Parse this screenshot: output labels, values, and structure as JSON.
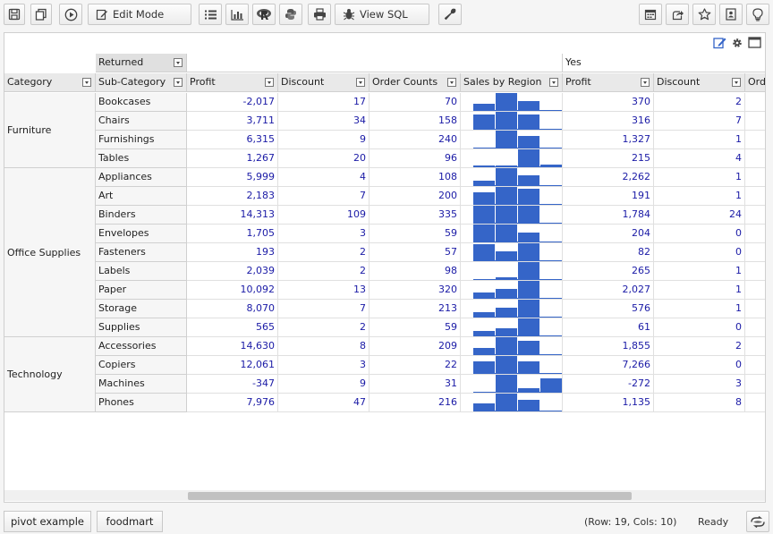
{
  "toolbar": {
    "edit_mode_label": "Edit Mode",
    "view_sql_label": "View SQL"
  },
  "grid": {
    "returned_label": "Returned",
    "yes_label": "Yes",
    "headers": {
      "category": "Category",
      "sub_category": "Sub-Category",
      "profit": "Profit",
      "discount": "Discount",
      "order_counts": "Order Counts",
      "sales_by_region": "Sales by Region",
      "order_counts_partial": "Ord"
    },
    "categories": [
      {
        "name": "Furniture",
        "start": 0,
        "span": 4
      },
      {
        "name": "Office Supplies",
        "start": 4,
        "span": 9
      },
      {
        "name": "Technology",
        "start": 13,
        "span": 4
      }
    ],
    "rows": [
      {
        "sub": "Bookcases",
        "profit": "-2,017",
        "discount": "17",
        "orders": "70",
        "spark": [
          0.4,
          1.0,
          0.55,
          0.05
        ],
        "y_profit": "370",
        "y_discount": "2"
      },
      {
        "sub": "Chairs",
        "profit": "3,711",
        "discount": "34",
        "orders": "158",
        "spark": [
          0.85,
          1.0,
          0.85,
          0.05
        ],
        "y_profit": "316",
        "y_discount": "7"
      },
      {
        "sub": "Furnishings",
        "profit": "6,315",
        "discount": "9",
        "orders": "240",
        "spark": [
          0.05,
          1.0,
          0.7,
          0.05
        ],
        "y_profit": "1,327",
        "y_discount": "1"
      },
      {
        "sub": "Tables",
        "profit": "1,267",
        "discount": "20",
        "orders": "96",
        "spark": [
          0.1,
          0.1,
          1.0,
          0.15
        ],
        "y_profit": "215",
        "y_discount": "4"
      },
      {
        "sub": "Appliances",
        "profit": "5,999",
        "discount": "4",
        "orders": "108",
        "spark": [
          0.3,
          1.0,
          0.6,
          0.05
        ],
        "y_profit": "2,262",
        "y_discount": "1"
      },
      {
        "sub": "Art",
        "profit": "2,183",
        "discount": "7",
        "orders": "200",
        "spark": [
          0.7,
          1.0,
          0.9,
          0.05
        ],
        "y_profit": "191",
        "y_discount": "1"
      },
      {
        "sub": "Binders",
        "profit": "14,313",
        "discount": "109",
        "orders": "335",
        "spark": [
          1.0,
          1.0,
          1.0,
          0.05
        ],
        "y_profit": "1,784",
        "y_discount": "24"
      },
      {
        "sub": "Envelopes",
        "profit": "1,705",
        "discount": "3",
        "orders": "59",
        "spark": [
          1.0,
          1.0,
          0.55,
          0.05
        ],
        "y_profit": "204",
        "y_discount": "0"
      },
      {
        "sub": "Fasteners",
        "profit": "193",
        "discount": "2",
        "orders": "57",
        "spark": [
          0.95,
          0.55,
          1.0,
          0.05
        ],
        "y_profit": "82",
        "y_discount": "0"
      },
      {
        "sub": "Labels",
        "profit": "2,039",
        "discount": "2",
        "orders": "98",
        "spark": [
          0.05,
          0.15,
          1.0,
          0.05
        ],
        "y_profit": "265",
        "y_discount": "1"
      },
      {
        "sub": "Paper",
        "profit": "10,092",
        "discount": "13",
        "orders": "320",
        "spark": [
          0.35,
          0.55,
          1.0,
          0.05
        ],
        "y_profit": "2,027",
        "y_discount": "1"
      },
      {
        "sub": "Storage",
        "profit": "8,070",
        "discount": "7",
        "orders": "213",
        "spark": [
          0.3,
          0.55,
          1.0,
          0.05
        ],
        "y_profit": "576",
        "y_discount": "1"
      },
      {
        "sub": "Supplies",
        "profit": "565",
        "discount": "2",
        "orders": "59",
        "spark": [
          0.3,
          0.45,
          1.0,
          0.05
        ],
        "y_profit": "61",
        "y_discount": "0"
      },
      {
        "sub": "Accessories",
        "profit": "14,630",
        "discount": "8",
        "orders": "209",
        "spark": [
          0.4,
          1.0,
          0.8,
          0.05
        ],
        "y_profit": "1,855",
        "y_discount": "2"
      },
      {
        "sub": "Copiers",
        "profit": "12,061",
        "discount": "3",
        "orders": "22",
        "spark": [
          0.7,
          1.0,
          0.7,
          0.05
        ],
        "y_profit": "7,266",
        "y_discount": "0"
      },
      {
        "sub": "Machines",
        "profit": "-347",
        "discount": "9",
        "orders": "31",
        "spark": [
          0.05,
          1.0,
          0.25,
          0.8
        ],
        "y_profit": "-272",
        "y_discount": "3"
      },
      {
        "sub": "Phones",
        "profit": "7,976",
        "discount": "47",
        "orders": "216",
        "spark": [
          0.45,
          1.0,
          0.65,
          0.05
        ],
        "y_profit": "1,135",
        "y_discount": "8"
      }
    ]
  },
  "statusbar": {
    "tabs": [
      "pivot example",
      "foodmart"
    ],
    "row_col": "(Row: 19, Cols: 10)",
    "state": "Ready"
  },
  "colors": {
    "accent_blue": "#3565c8",
    "number_text": "#1a1aa6",
    "header_bg": "#e9e9e9"
  },
  "icons": {
    "toolbar": [
      "save-icon",
      "copy-icon",
      "run-icon",
      "edit-icon",
      "list-icon",
      "chart-icon",
      "r-language-icon",
      "python-icon",
      "print-icon",
      "bug-icon",
      "wrench-icon",
      "calendar-icon",
      "share-icon",
      "star-icon",
      "user-card-icon",
      "lightbulb-icon"
    ],
    "panel": [
      "edit-icon",
      "gear-icon",
      "maximize-icon"
    ],
    "status": "refresh-icon"
  }
}
